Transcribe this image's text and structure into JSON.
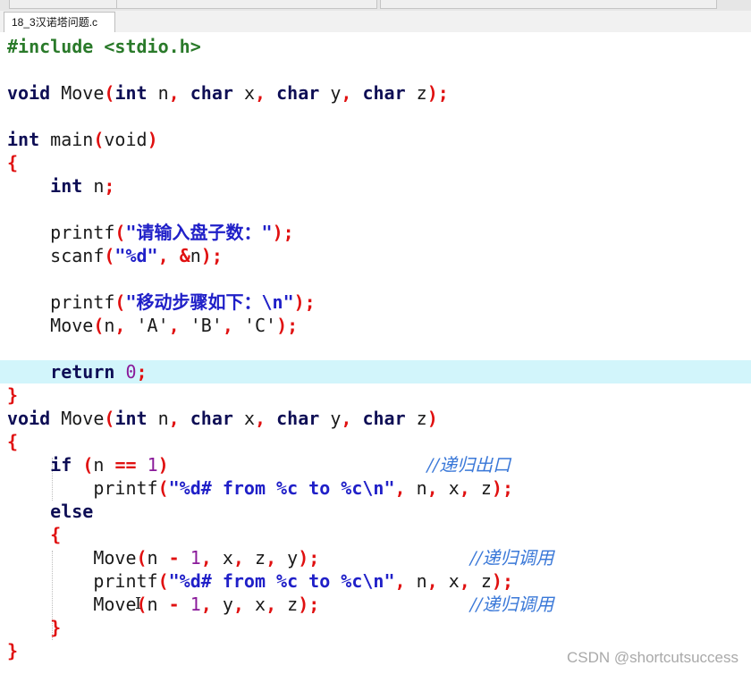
{
  "tab": {
    "title": "18_3汉诺塔问题.c"
  },
  "watermark": "CSDN @shortcutsuccess",
  "lines": [
    [
      [
        "pp",
        "#include <stdio.h>"
      ]
    ],
    [],
    [
      [
        "kw",
        "void"
      ],
      [
        "t",
        " Move"
      ],
      [
        "p",
        "("
      ],
      [
        "kw",
        "int"
      ],
      [
        "t",
        " n"
      ],
      [
        "p",
        ","
      ],
      [
        "t",
        " "
      ],
      [
        "kw",
        "char"
      ],
      [
        "t",
        " x"
      ],
      [
        "p",
        ","
      ],
      [
        "t",
        " "
      ],
      [
        "kw",
        "char"
      ],
      [
        "t",
        " y"
      ],
      [
        "p",
        ","
      ],
      [
        "t",
        " "
      ],
      [
        "kw",
        "char"
      ],
      [
        "t",
        " z"
      ],
      [
        "p",
        ");"
      ]
    ],
    [],
    [
      [
        "kw",
        "int"
      ],
      [
        "t",
        " main"
      ],
      [
        "p",
        "("
      ],
      [
        "t",
        "void"
      ],
      [
        "p",
        ")"
      ]
    ],
    [
      [
        "p",
        "{"
      ]
    ],
    [
      [
        "t",
        "    "
      ],
      [
        "kw",
        "int"
      ],
      [
        "t",
        " n"
      ],
      [
        "p",
        ";"
      ]
    ],
    [],
    [
      [
        "t",
        "    printf"
      ],
      [
        "p",
        "("
      ],
      [
        "str",
        "\"请输入盘子数：\""
      ],
      [
        "p",
        ");"
      ]
    ],
    [
      [
        "t",
        "    scanf"
      ],
      [
        "p",
        "("
      ],
      [
        "str",
        "\"%d\""
      ],
      [
        "p",
        ","
      ],
      [
        "t",
        " "
      ],
      [
        "p",
        "&"
      ],
      [
        "t",
        "n"
      ],
      [
        "p",
        ");"
      ]
    ],
    [],
    [
      [
        "t",
        "    printf"
      ],
      [
        "p",
        "("
      ],
      [
        "str",
        "\"移动步骤如下：\\n\""
      ],
      [
        "p",
        ");"
      ]
    ],
    [
      [
        "t",
        "    Move"
      ],
      [
        "p",
        "("
      ],
      [
        "t",
        "n"
      ],
      [
        "p",
        ","
      ],
      [
        "t",
        " 'A'"
      ],
      [
        "p",
        ","
      ],
      [
        "t",
        " 'B'"
      ],
      [
        "p",
        ","
      ],
      [
        "t",
        " 'C'"
      ],
      [
        "p",
        ");"
      ]
    ],
    [],
    [
      [
        "t",
        "    "
      ],
      [
        "kw",
        "return"
      ],
      [
        "t",
        " "
      ],
      [
        "num",
        "0"
      ],
      [
        "p",
        ";"
      ]
    ],
    [
      [
        "p",
        "}"
      ]
    ],
    [
      [
        "kw",
        "void"
      ],
      [
        "t",
        " Move"
      ],
      [
        "p",
        "("
      ],
      [
        "kw",
        "int"
      ],
      [
        "t",
        " n"
      ],
      [
        "p",
        ","
      ],
      [
        "t",
        " "
      ],
      [
        "kw",
        "char"
      ],
      [
        "t",
        " x"
      ],
      [
        "p",
        ","
      ],
      [
        "t",
        " "
      ],
      [
        "kw",
        "char"
      ],
      [
        "t",
        " y"
      ],
      [
        "p",
        ","
      ],
      [
        "t",
        " "
      ],
      [
        "kw",
        "char"
      ],
      [
        "t",
        " z"
      ],
      [
        "p",
        ")"
      ]
    ],
    [
      [
        "p",
        "{"
      ]
    ],
    [
      [
        "t",
        "    "
      ],
      [
        "kw",
        "if"
      ],
      [
        "t",
        " "
      ],
      [
        "p",
        "("
      ],
      [
        "t",
        "n "
      ],
      [
        "p",
        "=="
      ],
      [
        "t",
        " "
      ],
      [
        "num",
        "1"
      ],
      [
        "p",
        ")"
      ],
      [
        "t",
        "                        "
      ],
      [
        "cm",
        "//递归出口"
      ]
    ],
    [
      [
        "t",
        "        printf"
      ],
      [
        "p",
        "("
      ],
      [
        "str",
        "\"%d# from %c to %c\\n\""
      ],
      [
        "p",
        ","
      ],
      [
        "t",
        " n"
      ],
      [
        "p",
        ","
      ],
      [
        "t",
        " x"
      ],
      [
        "p",
        ","
      ],
      [
        "t",
        " z"
      ],
      [
        "p",
        ");"
      ]
    ],
    [
      [
        "t",
        "    "
      ],
      [
        "kw",
        "else"
      ]
    ],
    [
      [
        "t",
        "    "
      ],
      [
        "p",
        "{"
      ]
    ],
    [
      [
        "t",
        "        Move"
      ],
      [
        "p",
        "("
      ],
      [
        "t",
        "n "
      ],
      [
        "p",
        "-"
      ],
      [
        "t",
        " "
      ],
      [
        "num",
        "1"
      ],
      [
        "p",
        ","
      ],
      [
        "t",
        " x"
      ],
      [
        "p",
        ","
      ],
      [
        "t",
        " z"
      ],
      [
        "p",
        ","
      ],
      [
        "t",
        " y"
      ],
      [
        "p",
        ");"
      ],
      [
        "t",
        "              "
      ],
      [
        "cm",
        "//递归调用"
      ]
    ],
    [
      [
        "t",
        "        printf"
      ],
      [
        "p",
        "("
      ],
      [
        "str",
        "\"%d# from %c to %c\\n\""
      ],
      [
        "p",
        ","
      ],
      [
        "t",
        " n"
      ],
      [
        "p",
        ","
      ],
      [
        "t",
        " x"
      ],
      [
        "p",
        ","
      ],
      [
        "t",
        " z"
      ],
      [
        "p",
        ");"
      ]
    ],
    [
      [
        "t",
        "        Move"
      ],
      [
        "p",
        "("
      ],
      [
        "t",
        "n "
      ],
      [
        "p",
        "-"
      ],
      [
        "t",
        " "
      ],
      [
        "num",
        "1"
      ],
      [
        "p",
        ","
      ],
      [
        "t",
        " y"
      ],
      [
        "p",
        ","
      ],
      [
        "t",
        " x"
      ],
      [
        "p",
        ","
      ],
      [
        "t",
        " z"
      ],
      [
        "p",
        ");"
      ],
      [
        "t",
        "              "
      ],
      [
        "cm",
        "//递归调用"
      ]
    ],
    [
      [
        "t",
        "    "
      ],
      [
        "p",
        "}"
      ]
    ],
    [
      [
        "p",
        "}"
      ]
    ]
  ],
  "current_line": 14,
  "cursor_glyph": "I"
}
